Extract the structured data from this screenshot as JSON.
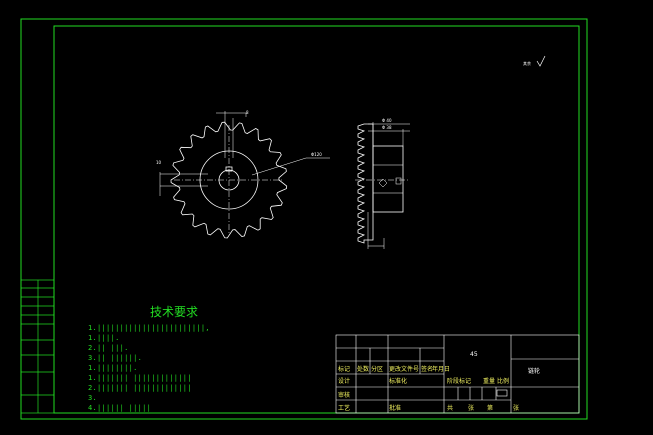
{
  "tech_req": {
    "title": "技术要求",
    "lines": [
      "1.||||||||||||||||||||||||,",
      "1.||||.",
      "2.|| |||.",
      "3.|| ||||||.",
      "1.||||||||.",
      "1.||||||| |||||||||||||",
      "2.||||||| |||||||||||||",
      "3.",
      "4.|||||| |||||"
    ]
  },
  "roughness_mark": "其余",
  "dims": {
    "outer_dia": "Φ120",
    "hub_dia_1": "Φ 40",
    "hub_dia_2": "Φ 38",
    "key_w": "8",
    "key_h": "10"
  },
  "title_block": {
    "mark": "标记",
    "count": "处数",
    "zone": "分区",
    "change_doc": "更改文件号",
    "signature": "签名",
    "date": "年月日",
    "designer": "设计",
    "standardize": "标准化",
    "checker": "审核",
    "process": "工艺",
    "approve": "批准",
    "stage_mark": "阶段标记",
    "weight": "重量",
    "scale": "比例",
    "total": "共",
    "sheet": "张",
    "page": "第",
    "material": "45",
    "drawing_name": "链轮"
  }
}
